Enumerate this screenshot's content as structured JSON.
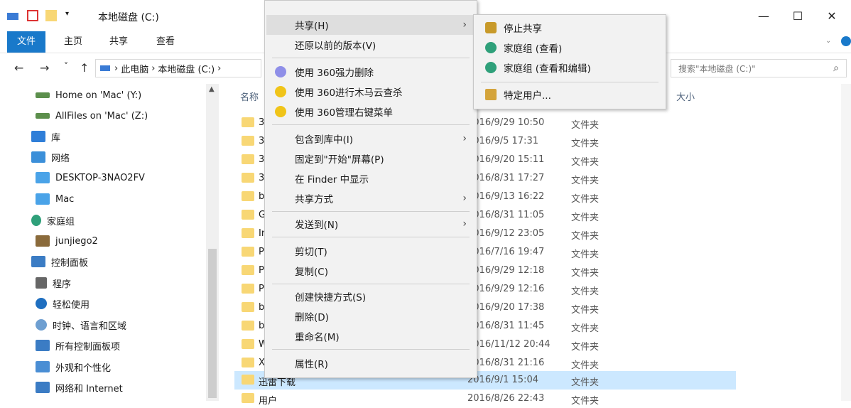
{
  "window": {
    "title": "本地磁盘 (C:)",
    "minimize_glyph": "—",
    "maximize_glyph": "☐",
    "close_glyph": "✕"
  },
  "ribbon": {
    "tabs": [
      "文件",
      "主页",
      "共享",
      "查看"
    ],
    "active_tab": "文件",
    "accent": "#1979ca"
  },
  "nav": {
    "back": "←",
    "forward": "→",
    "recent": "˅",
    "up": "↑",
    "breadcrumb": [
      "此电脑",
      "本地磁盘 (C:)"
    ],
    "search_placeholder": "搜索\"本地磁盘 (C:)\""
  },
  "sidebar": {
    "items": [
      {
        "label": "Home on 'Mac' (Y:)",
        "icon": "network-drive-icon"
      },
      {
        "label": "AllFiles on 'Mac' (Z:)",
        "icon": "network-drive-icon"
      },
      {
        "label": "库",
        "icon": "library-icon"
      },
      {
        "label": "网络",
        "icon": "network-icon"
      },
      {
        "label": "DESKTOP-3NAO2FV",
        "icon": "computer-icon"
      },
      {
        "label": "Mac",
        "icon": "computer-icon"
      },
      {
        "label": "家庭组",
        "icon": "homegroup-icon"
      },
      {
        "label": "junjiego2",
        "icon": "user-icon"
      },
      {
        "label": "控制面板",
        "icon": "control-panel-icon"
      },
      {
        "label": "程序",
        "icon": "programs-icon"
      },
      {
        "label": "轻松使用",
        "icon": "accessibility-icon"
      },
      {
        "label": "时钟、语言和区域",
        "icon": "clock-icon"
      },
      {
        "label": "所有控制面板项",
        "icon": "control-panel-icon"
      },
      {
        "label": "外观和个性化",
        "icon": "appearance-icon"
      },
      {
        "label": "网络和 Internet",
        "icon": "network-internet-icon"
      }
    ]
  },
  "filelist": {
    "columns": {
      "name": "名称",
      "size": "大小"
    },
    "rows": [
      {
        "name": "3",
        "date": "2016/9/29 10:50",
        "type": "文件夹"
      },
      {
        "name": "3",
        "date": "2016/9/5 17:31",
        "type": "文件夹"
      },
      {
        "name": "3",
        "date": "2016/9/20 15:11",
        "type": "文件夹"
      },
      {
        "name": "3",
        "date": "2016/8/31 17:27",
        "type": "文件夹"
      },
      {
        "name": "b",
        "date": "2016/9/13 16:22",
        "type": "文件夹"
      },
      {
        "name": "G",
        "date": "2016/8/31 11:05",
        "type": "文件夹"
      },
      {
        "name": "In",
        "date": "2016/9/12 23:05",
        "type": "文件夹"
      },
      {
        "name": "P",
        "date": "2016/7/16 19:47",
        "type": "文件夹"
      },
      {
        "name": "P",
        "date": "2016/9/29 12:18",
        "type": "文件夹"
      },
      {
        "name": "P",
        "date": "2016/9/29 12:16",
        "type": "文件夹"
      },
      {
        "name": "b",
        "date": "2016/9/20 17:38",
        "type": "文件夹"
      },
      {
        "name": "b",
        "date": "2016/8/31 11:45",
        "type": "文件夹"
      },
      {
        "name": "W",
        "date": "2016/11/12 20:44",
        "type": "文件夹"
      },
      {
        "name": "X",
        "date": "2016/8/31 21:16",
        "type": "文件夹"
      },
      {
        "name": "迅雷下载",
        "date": "2016/9/1 15:04",
        "type": "文件夹"
      },
      {
        "name": "用户",
        "date": "2016/8/26 22:43",
        "type": "文件夹"
      }
    ],
    "selected_row": "迅雷下载"
  },
  "context_menu": {
    "items": [
      {
        "label": "共享(H)",
        "submenu": true,
        "hover": true
      },
      {
        "label": "还原以前的版本(V)"
      },
      {
        "sep": true
      },
      {
        "label": "使用 360强力删除",
        "icon": "360-shred-icon"
      },
      {
        "label": "使用 360进行木马云查杀",
        "icon": "360-scan-icon"
      },
      {
        "label": "使用 360管理右键菜单",
        "icon": "360-menu-icon"
      },
      {
        "sep": true
      },
      {
        "label": "包含到库中(I)",
        "submenu": true
      },
      {
        "label": "固定到\"开始\"屏幕(P)"
      },
      {
        "label": "在 Finder 中显示"
      },
      {
        "label": "共享方式",
        "submenu": true
      },
      {
        "sep": true
      },
      {
        "label": "发送到(N)",
        "submenu": true
      },
      {
        "sep": true
      },
      {
        "label": "剪切(T)"
      },
      {
        "label": "复制(C)"
      },
      {
        "sep": true
      },
      {
        "label": "创建快捷方式(S)"
      },
      {
        "label": "删除(D)"
      },
      {
        "label": "重命名(M)"
      },
      {
        "sep": true
      },
      {
        "label": "属性(R)"
      }
    ],
    "arrow_glyph": "›"
  },
  "share_submenu": {
    "items": [
      {
        "label": "停止共享",
        "icon": "lock-icon"
      },
      {
        "label": "家庭组 (查看)",
        "icon": "homegroup-icon"
      },
      {
        "label": "家庭组 (查看和编辑)",
        "icon": "homegroup-icon"
      },
      {
        "sep": true
      },
      {
        "label": "特定用户...",
        "icon": "users-icon"
      }
    ]
  }
}
